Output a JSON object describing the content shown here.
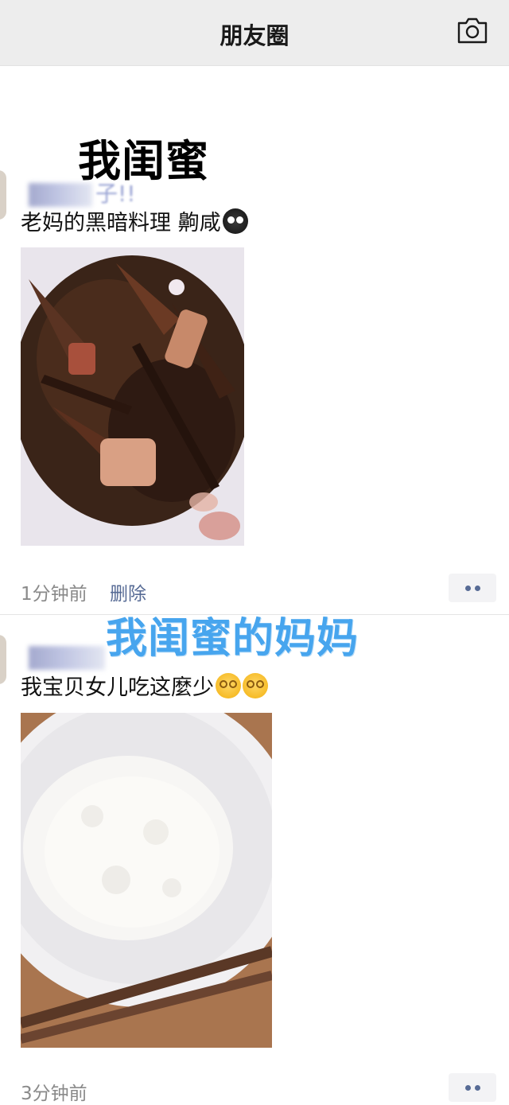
{
  "header": {
    "title": "朋友圈",
    "camera_icon": "camera-icon"
  },
  "overlays": {
    "top_caption": "我闺蜜",
    "middle_caption": "我闺蜜的妈妈"
  },
  "posts": [
    {
      "name_tail": "子!!",
      "text": "老妈的黑暗料理 齁咸",
      "emojis": [
        "dark-face-emoji"
      ],
      "image": "food-photo",
      "time": "1分钟前",
      "delete_label": "删除",
      "more_icon": "more-dots-icon"
    },
    {
      "text": "我宝贝女儿吃这麼少",
      "emojis": [
        "dizzy-face-emoji",
        "dizzy-face-emoji"
      ],
      "image": "rice-bowl-photo",
      "time": "3分钟前",
      "more_icon": "more-dots-icon"
    }
  ],
  "colors": {
    "header_bg": "#ededed",
    "link": "#576b95",
    "meta_gray": "#8a8a8a",
    "caption_blue": "#47a5ee"
  }
}
